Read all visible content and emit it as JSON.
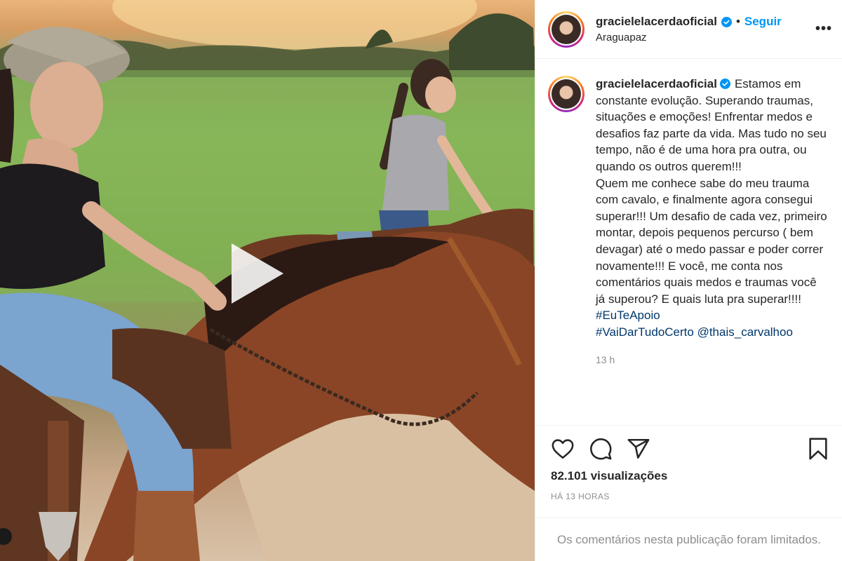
{
  "media": {
    "play_icon": "play-icon"
  },
  "header": {
    "username": "gracielelacerdaoficial",
    "separator": "•",
    "follow_label": "Seguir",
    "location": "Araguapaz",
    "more_label": "•••"
  },
  "caption": {
    "username": "gracielelacerdaoficial",
    "text": "Estamos em constante evolução. Superando traumas, situações e emoções! Enfrentar medos e desafios faz parte da vida. Mas tudo no seu tempo, não é de uma hora pra outra, ou quando os outros querem!!!",
    "text2": "Quem me conhece sabe do meu trauma com cavalo, e finalmente agora consegui superar!!! Um desafio de cada vez, primeiro montar, depois pequenos percurso ( bem devagar) até o medo passar e poder correr novamente!!! E você, me conta nos comentários quais medos e traumas você já superou? E quais luta pra superar!!!! ",
    "hashtag1": "#EuTeApoio",
    "hashtag2": "#VaiDarTudoCerto",
    "mention": "@thais_carvalhoo",
    "time": "13 h"
  },
  "actions": {
    "like_icon": "heart-icon",
    "comment_icon": "comment-icon",
    "share_icon": "send-icon",
    "save_icon": "bookmark-icon"
  },
  "stats": {
    "views": "82.101 visualizações",
    "ago": "HÁ 13 HORAS"
  },
  "footer": {
    "limited": "Os comentários nesta publicação foram limitados."
  },
  "colors": {
    "accent": "#0095f6",
    "link": "#00376b",
    "muted": "#8e8e8e"
  }
}
